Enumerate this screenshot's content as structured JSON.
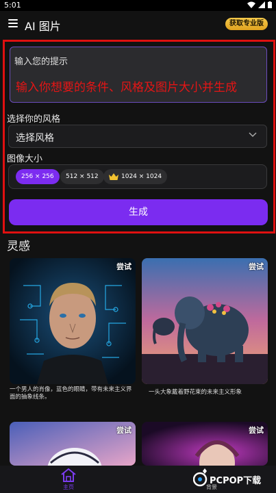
{
  "status": {
    "time": "5:01"
  },
  "appbar": {
    "title": "AI 图片",
    "pro_label": "获取专业版"
  },
  "prompt": {
    "placeholder": "输入您的提示",
    "annotation": "输入你想要的条件、风格及图片大小并生成"
  },
  "style": {
    "label": "选择你的风格",
    "value": "选择风格"
  },
  "size": {
    "label": "图像大小",
    "options": [
      "256 × 256",
      "512 × 512",
      "1024 × 1024"
    ],
    "selected": "256 × 256"
  },
  "generate_label": "生成",
  "inspiration": {
    "title": "灵感",
    "cards": [
      {
        "badge": "尝试",
        "caption": "一个男人的肖像，蓝色的眼睛，带有未来主义界面的抽象线条。"
      },
      {
        "badge": "尝试",
        "caption": "一头大象戴着野花束的未来主义形象"
      },
      {
        "badge": "尝试",
        "caption": ""
      },
      {
        "badge": "尝试",
        "caption": ""
      }
    ]
  },
  "nav": {
    "home_label": "主页",
    "background_label": "背景"
  },
  "watermark": "PCPOP下载",
  "colors": {
    "accent": "#7b2cf0",
    "highlight": "#e01010",
    "background": "#121212"
  }
}
